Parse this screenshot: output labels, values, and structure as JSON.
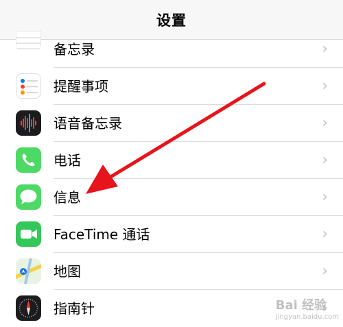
{
  "header": {
    "title": "设置"
  },
  "settings": {
    "items": [
      {
        "label": "备忘录",
        "icon": "notes-icon"
      },
      {
        "label": "提醒事项",
        "icon": "reminders-icon"
      },
      {
        "label": "语音备忘录",
        "icon": "voice-memos-icon"
      },
      {
        "label": "电话",
        "icon": "phone-icon"
      },
      {
        "label": "信息",
        "icon": "messages-icon"
      },
      {
        "label": "FaceTime 通话",
        "icon": "facetime-icon"
      },
      {
        "label": "地图",
        "icon": "maps-icon"
      },
      {
        "label": "指南针",
        "icon": "compass-icon"
      }
    ],
    "chevron": "›"
  },
  "annotation": {
    "arrow_color": "#e8141b",
    "points_to": "信息"
  },
  "watermark": {
    "text": "Bai 经验",
    "sub": "jingyan.baidu.com"
  },
  "colors": {
    "phone_green": "#4cd964",
    "messages_green": "#4cd964",
    "facetime_green": "#34c759",
    "navbar_bg": "#f7f7f7"
  }
}
